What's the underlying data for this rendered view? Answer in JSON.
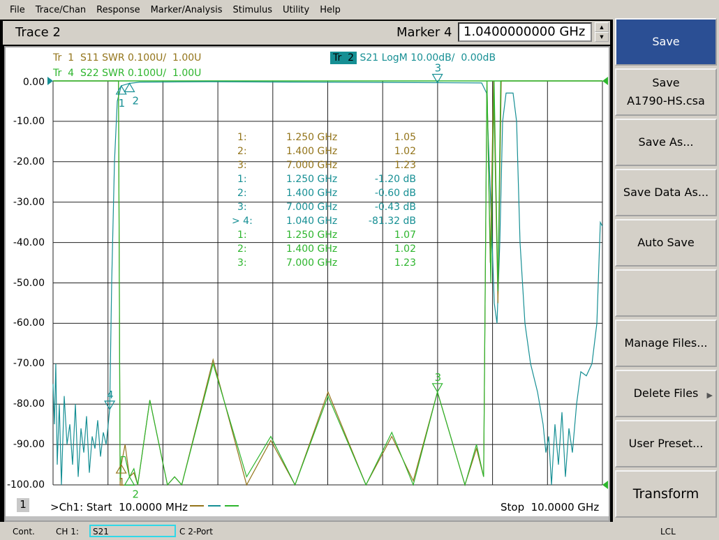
{
  "menu": [
    "File",
    "Trace/Chan",
    "Response",
    "Marker/Analysis",
    "Stimulus",
    "Utility",
    "Help"
  ],
  "title": "Trace 2",
  "marker_entry": {
    "label": "Marker 4",
    "value": "1.0400000000 GHz"
  },
  "traces": {
    "tr1": {
      "id": "Tr  1",
      "text": "S11 SWR 0.100U/  1.00U",
      "color": "#93741a"
    },
    "tr2": {
      "id": "Tr  2",
      "text": "S21 LogM 10.00dB/  0.00dB",
      "color": "#168f94",
      "active": true
    },
    "tr4": {
      "id": "Tr  4",
      "text": "S22 SWR 0.100U/  1.00U",
      "color": "#2db52d"
    }
  },
  "marker_table": [
    {
      "num": "1:",
      "freq": "1.250 GHz",
      "val": "1.05",
      "trace": "tr1"
    },
    {
      "num": "2:",
      "freq": "1.400 GHz",
      "val": "1.02",
      "trace": "tr1"
    },
    {
      "num": "3:",
      "freq": "7.000 GHz",
      "val": "1.23",
      "trace": "tr1"
    },
    {
      "num": "1:",
      "freq": "1.250 GHz",
      "val": "-1.20 dB",
      "trace": "tr2"
    },
    {
      "num": "2:",
      "freq": "1.400 GHz",
      "val": "-0.60 dB",
      "trace": "tr2"
    },
    {
      "num": "3:",
      "freq": "7.000 GHz",
      "val": "-0.43 dB",
      "trace": "tr2"
    },
    {
      "num": "> 4:",
      "freq": "1.040 GHz",
      "val": "-81.32 dB",
      "trace": "tr2"
    },
    {
      "num": "1:",
      "freq": "1.250 GHz",
      "val": "1.07",
      "trace": "tr4"
    },
    {
      "num": "2:",
      "freq": "1.400 GHz",
      "val": "1.02",
      "trace": "tr4"
    },
    {
      "num": "3:",
      "freq": "7.000 GHz",
      "val": "1.23",
      "trace": "tr4"
    }
  ],
  "chart_data": {
    "type": "line",
    "xlim": [
      0.01,
      10.0
    ],
    "ylim": [
      -100,
      0
    ],
    "swr_lim": [
      1.0,
      2.0
    ],
    "grid": true,
    "yticks": [
      "0.00",
      "-10.00",
      "-20.00",
      "-30.00",
      "-40.00",
      "-50.00",
      "-60.00",
      "-70.00",
      "-80.00",
      "-90.00",
      "-100.00"
    ],
    "series": [
      {
        "name": "S21",
        "color": "#168f94",
        "unit": "dB",
        "points": [
          [
            0.01,
            -75
          ],
          [
            0.035,
            -85
          ],
          [
            0.06,
            -70
          ],
          [
            0.086,
            -95
          ],
          [
            0.124,
            -80
          ],
          [
            0.162,
            -100
          ],
          [
            0.213,
            -78
          ],
          [
            0.264,
            -90
          ],
          [
            0.315,
            -85
          ],
          [
            0.365,
            -95
          ],
          [
            0.416,
            -80
          ],
          [
            0.467,
            -98
          ],
          [
            0.518,
            -86
          ],
          [
            0.569,
            -92
          ],
          [
            0.619,
            -83
          ],
          [
            0.67,
            -97
          ],
          [
            0.721,
            -88
          ],
          [
            0.772,
            -91
          ],
          [
            0.822,
            -84
          ],
          [
            0.873,
            -93
          ],
          [
            0.924,
            -87
          ],
          [
            0.975,
            -90
          ],
          [
            1.013,
            -85
          ],
          [
            1.04,
            -81.32
          ],
          [
            1.076,
            -50
          ],
          [
            1.127,
            -20
          ],
          [
            1.178,
            -5
          ],
          [
            1.25,
            -1.2
          ],
          [
            1.4,
            -0.6
          ],
          [
            1.584,
            -0.3
          ],
          [
            2.853,
            -0.2
          ],
          [
            7.0,
            -0.43
          ],
          [
            7.804,
            -0.5
          ],
          [
            7.893,
            -3
          ],
          [
            7.969,
            -30
          ],
          [
            8.033,
            -55
          ],
          [
            8.083,
            -60
          ],
          [
            8.134,
            -40
          ],
          [
            8.185,
            -10
          ],
          [
            8.248,
            -3
          ],
          [
            8.375,
            -3
          ],
          [
            8.439,
            -10
          ],
          [
            8.502,
            -40
          ],
          [
            8.591,
            -60
          ],
          [
            8.693,
            -70
          ],
          [
            8.82,
            -77
          ],
          [
            8.921,
            -85
          ],
          [
            8.972,
            -92
          ],
          [
            9.023,
            -88
          ],
          [
            9.074,
            -100
          ],
          [
            9.137,
            -85
          ],
          [
            9.2,
            -95
          ],
          [
            9.264,
            -82
          ],
          [
            9.327,
            -98
          ],
          [
            9.391,
            -86
          ],
          [
            9.454,
            -92
          ],
          [
            9.53,
            -80
          ],
          [
            9.607,
            -72
          ],
          [
            9.708,
            -73
          ],
          [
            9.81,
            -70
          ],
          [
            9.899,
            -60
          ],
          [
            9.962,
            -35
          ],
          [
            10.0,
            -36
          ]
        ]
      },
      {
        "name": "S11",
        "color": "#93741a",
        "unit": "SWR",
        "points": [
          [
            0.01,
            2.0
          ],
          [
            1.2,
            2.0
          ],
          [
            1.23,
            1.0
          ],
          [
            1.25,
            1.05
          ],
          [
            1.32,
            1.1
          ],
          [
            1.4,
            1.02
          ],
          [
            1.48,
            1.03
          ],
          [
            1.55,
            1.0
          ],
          [
            1.77,
            1.21
          ],
          [
            2.09,
            1.0
          ],
          [
            2.22,
            1.02
          ],
          [
            2.35,
            0.99
          ],
          [
            2.92,
            1.31
          ],
          [
            3.53,
            1.0
          ],
          [
            3.97,
            1.11
          ],
          [
            4.41,
            0.99
          ],
          [
            5.01,
            1.23
          ],
          [
            5.7,
            1.0
          ],
          [
            6.17,
            1.12
          ],
          [
            6.56,
            1.01
          ],
          [
            7.0,
            1.23
          ],
          [
            7.5,
            1.0
          ],
          [
            7.71,
            1.09
          ],
          [
            7.84,
            1.02
          ],
          [
            7.9,
            2.0
          ],
          [
            7.96,
            1.55
          ],
          [
            8.02,
            2.0
          ],
          [
            8.1,
            1.45
          ],
          [
            8.16,
            2.0
          ],
          [
            10.0,
            2.0
          ]
        ]
      },
      {
        "name": "S22",
        "color": "#2db52d",
        "unit": "SWR",
        "points": [
          [
            0.01,
            2.0
          ],
          [
            1.2,
            2.0
          ],
          [
            1.23,
            1.01
          ],
          [
            1.25,
            1.07
          ],
          [
            1.32,
            1.07
          ],
          [
            1.4,
            1.02
          ],
          [
            1.48,
            1.04
          ],
          [
            1.55,
            1.0
          ],
          [
            1.77,
            1.21
          ],
          [
            2.09,
            1.0
          ],
          [
            2.22,
            1.02
          ],
          [
            2.35,
            1.0
          ],
          [
            2.92,
            1.3
          ],
          [
            3.53,
            1.02
          ],
          [
            3.97,
            1.12
          ],
          [
            4.41,
            1.0
          ],
          [
            5.01,
            1.22
          ],
          [
            5.7,
            1.0
          ],
          [
            6.17,
            1.13
          ],
          [
            6.56,
            1.0
          ],
          [
            7.0,
            1.23
          ],
          [
            7.5,
            1.0
          ],
          [
            7.71,
            1.1
          ],
          [
            7.84,
            1.02
          ],
          [
            7.9,
            2.0
          ],
          [
            7.97,
            1.5
          ],
          [
            8.03,
            2.0
          ],
          [
            8.1,
            1.48
          ],
          [
            8.15,
            2.0
          ],
          [
            10.0,
            2.0
          ]
        ]
      }
    ],
    "markers": [
      {
        "series": "S21",
        "label": "1",
        "x": 1.25,
        "y": -1.2,
        "dir": "up"
      },
      {
        "series": "S21",
        "label": "2",
        "x": 1.4,
        "y": -0.6,
        "dir": "up"
      },
      {
        "series": "S21",
        "label": "3",
        "x": 7.0,
        "y": -0.43,
        "dir": "down"
      },
      {
        "series": "S21",
        "label": "4",
        "x": 1.04,
        "y": -81.32,
        "dir": "down"
      },
      {
        "series": "S22",
        "label": "3",
        "x": 7.0,
        "y": 1.23,
        "dir": "down"
      },
      {
        "series": "S11",
        "label": "1",
        "x": 1.25,
        "y": 1.05,
        "dir": "up"
      },
      {
        "series": "S22",
        "label": "2",
        "x": 1.4,
        "y": 1.02,
        "dir": "up"
      }
    ]
  },
  "footer": {
    "channel": "1",
    "start": ">Ch1: Start  10.0000 MHz",
    "stop": "Stop  10.0000 GHz"
  },
  "softkeys": [
    {
      "label": "Save",
      "active": true
    },
    {
      "label": "Save",
      "sub": "A1790-HS.csa"
    },
    {
      "label": "Save As..."
    },
    {
      "label": "Save Data As..."
    },
    {
      "label": "Auto Save"
    },
    {
      "label": ""
    },
    {
      "label": "Manage Files..."
    },
    {
      "label": "Delete Files",
      "arrow": "▶"
    },
    {
      "label": "User Preset..."
    },
    {
      "label": "Transform"
    }
  ],
  "status": {
    "mode": "Cont.",
    "ch": "CH 1:",
    "param": "S21",
    "port": "C  2-Port",
    "remote": "LCL"
  }
}
